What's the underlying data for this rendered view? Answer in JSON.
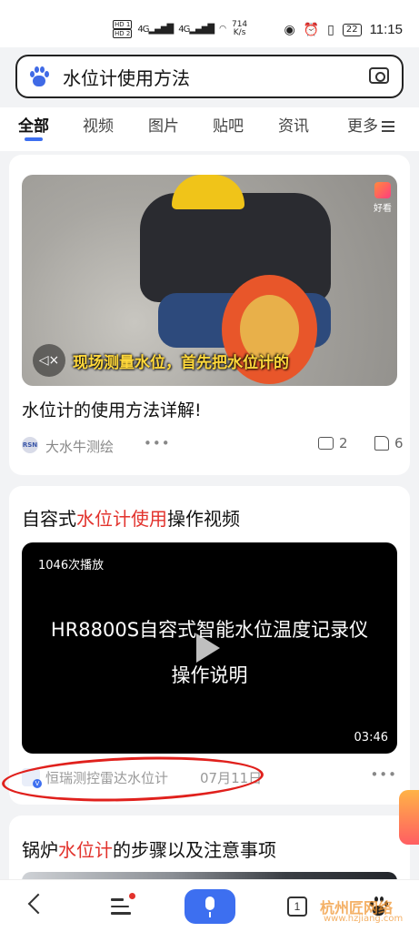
{
  "status_bar": {
    "hd1": "HD 1",
    "hd2": "HD 2",
    "net1": "4G",
    "net2": "4G",
    "speed_value": "714",
    "speed_unit": "K/s",
    "battery": "22",
    "time": "11:15"
  },
  "search": {
    "query": "水位计使用方法"
  },
  "tabs": [
    {
      "label": "全部",
      "active": true
    },
    {
      "label": "视频"
    },
    {
      "label": "图片"
    },
    {
      "label": "贴吧"
    },
    {
      "label": "资讯"
    },
    {
      "label": "更多"
    }
  ],
  "result1": {
    "badge": "好看",
    "subtitle": "现场测量水位，首先把水位计的",
    "title": "水位计的使用方法详解!",
    "source": "大水牛测绘",
    "source_logo": "RSN",
    "comments": "2",
    "likes": "6"
  },
  "result2": {
    "title_prefix": "自容式",
    "title_highlight": "水位计使用",
    "title_suffix": "操作视频",
    "plays": "1046次播放",
    "video_line1": "HR8800S自容式智能水位温度记录仪",
    "video_line2": "操作说明",
    "duration": "03:46",
    "source": "恒瑞测控雷达水位计",
    "date": "07月11日"
  },
  "result3": {
    "title_prefix": "锅炉",
    "title_highlight": "水位计",
    "title_suffix": "的步骤以及注意事项"
  },
  "bottom_nav": {
    "tab_count": "1"
  },
  "watermark": {
    "text": "杭州匠网络",
    "sub": "www.hzjiang.com"
  },
  "colors": {
    "accent": "#3d6ff0",
    "highlight": "#e2322c",
    "annotation_ring": "#e0201c"
  }
}
